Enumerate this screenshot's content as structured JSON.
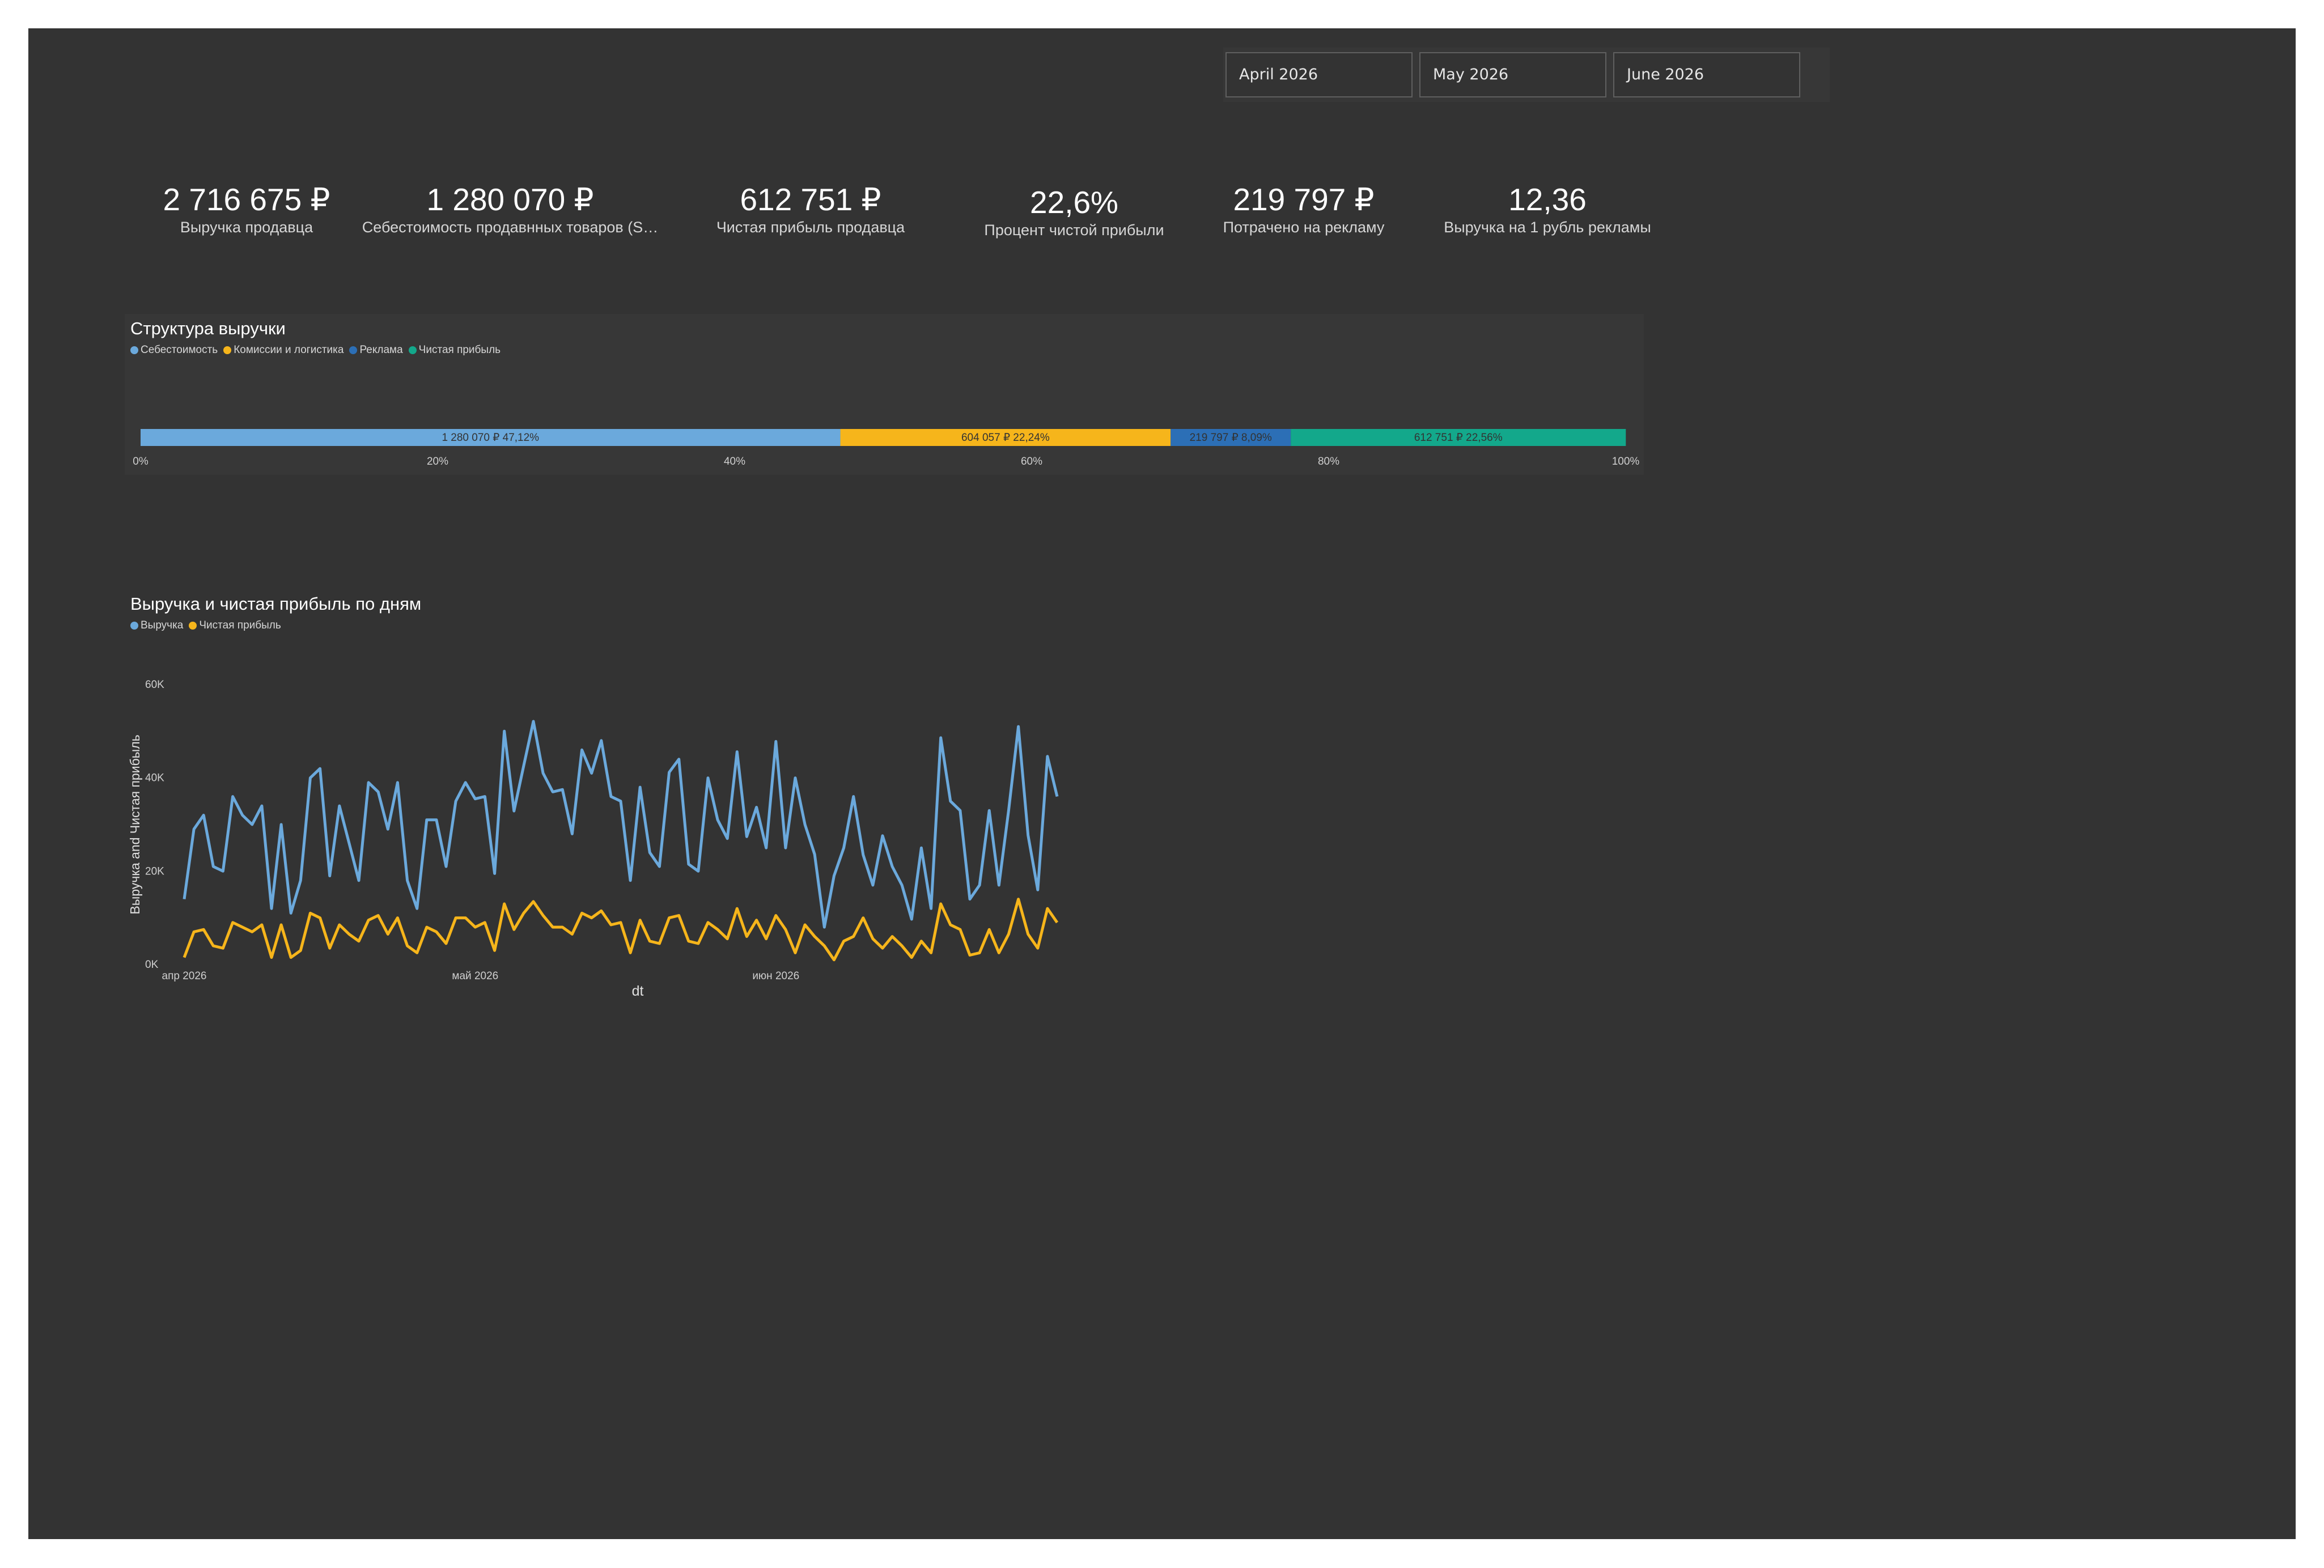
{
  "slicers": [
    {
      "label": "April 2026"
    },
    {
      "label": "May 2026"
    },
    {
      "label": "June 2026"
    }
  ],
  "kpis": [
    {
      "value": "2 716 675 ₽",
      "label": "Выручка продавца"
    },
    {
      "value": "1 280 070 ₽",
      "label": "Себестоимость продавнных товаров (S…"
    },
    {
      "value": "612 751 ₽",
      "label": "Чистая прибыль продавца"
    },
    {
      "value": "22,6%",
      "label": "Процент чистой прибыли"
    },
    {
      "value": "219 797 ₽",
      "label": "Потрачено на рекламу"
    },
    {
      "value": "12,36",
      "label": "Выручка на 1 рубль рекламы"
    }
  ],
  "structure": {
    "title": "Структура выручки",
    "legend": [
      {
        "label": "Себестоимость",
        "color": "#6ba9dc"
      },
      {
        "label": "Комиссии и логистика",
        "color": "#f6b51b"
      },
      {
        "label": "Реклама",
        "color": "#2c6fb6"
      },
      {
        "label": "Чистая прибыль",
        "color": "#13a88b"
      }
    ]
  },
  "daily": {
    "title": "Выручка и чистая прибыль по дням",
    "legend": [
      {
        "label": "Выручка",
        "color": "#6ba9dc"
      },
      {
        "label": "Чистая прибыль",
        "color": "#f6b51b"
      }
    ]
  },
  "chart_data": [
    {
      "type": "bar",
      "subtype": "100% stacked horizontal",
      "title": "Структура выручки",
      "series": [
        {
          "name": "Себестоимость",
          "value": 1280070,
          "percent": 47.12,
          "label": "1 280 070 ₽ 47,12%",
          "color": "#6ba9dc"
        },
        {
          "name": "Комиссии и логистика",
          "value": 604057,
          "percent": 22.24,
          "label": "604 057 ₽ 22,24%",
          "color": "#f6b51b"
        },
        {
          "name": "Реклама",
          "value": 219797,
          "percent": 8.09,
          "label": "219 797 ₽ 8,09%",
          "color": "#2c6fb6"
        },
        {
          "name": "Чистая прибыль",
          "value": 612751,
          "percent": 22.56,
          "label": "612 751 ₽ 22,56%",
          "color": "#13a88b"
        }
      ],
      "xticks": [
        "0%",
        "20%",
        "40%",
        "60%",
        "80%",
        "100%"
      ],
      "xlim": [
        0,
        100
      ],
      "legend": "top-left"
    },
    {
      "type": "line",
      "title": "Выручка и чистая прибыль по дням",
      "xlabel": "dt",
      "ylabel": "Выручка and Чистая прибыль",
      "x": [
        "2026-04-01",
        "2026-04-02",
        "2026-04-03",
        "2026-04-04",
        "2026-04-05",
        "2026-04-06",
        "2026-04-07",
        "2026-04-08",
        "2026-04-09",
        "2026-04-10",
        "2026-04-11",
        "2026-04-12",
        "2026-04-13",
        "2026-04-14",
        "2026-04-15",
        "2026-04-16",
        "2026-04-17",
        "2026-04-18",
        "2026-04-19",
        "2026-04-20",
        "2026-04-21",
        "2026-04-22",
        "2026-04-23",
        "2026-04-24",
        "2026-04-25",
        "2026-04-26",
        "2026-04-27",
        "2026-04-28",
        "2026-04-29",
        "2026-04-30",
        "2026-05-01",
        "2026-05-02",
        "2026-05-03",
        "2026-05-04",
        "2026-05-05",
        "2026-05-06",
        "2026-05-07",
        "2026-05-08",
        "2026-05-09",
        "2026-05-10",
        "2026-05-11",
        "2026-05-12",
        "2026-05-13",
        "2026-05-14",
        "2026-05-15",
        "2026-05-16",
        "2026-05-17",
        "2026-05-18",
        "2026-05-19",
        "2026-05-20",
        "2026-05-21",
        "2026-05-22",
        "2026-05-23",
        "2026-05-24",
        "2026-05-25",
        "2026-05-26",
        "2026-05-27",
        "2026-05-28",
        "2026-05-29",
        "2026-05-30",
        "2026-05-31",
        "2026-06-01",
        "2026-06-02",
        "2026-06-03",
        "2026-06-04",
        "2026-06-05",
        "2026-06-06",
        "2026-06-07",
        "2026-06-08",
        "2026-06-09",
        "2026-06-10",
        "2026-06-11",
        "2026-06-12",
        "2026-06-13",
        "2026-06-14",
        "2026-06-15",
        "2026-06-16",
        "2026-06-17",
        "2026-06-18",
        "2026-06-19",
        "2026-06-20",
        "2026-06-21",
        "2026-06-22",
        "2026-06-23",
        "2026-06-24",
        "2026-06-25",
        "2026-06-26",
        "2026-06-27",
        "2026-06-28",
        "2026-06-29",
        "2026-06-30"
      ],
      "series": [
        {
          "name": "Выручка",
          "color": "#6ba9dc",
          "values": [
            14000,
            29000,
            32000,
            21000,
            20000,
            36000,
            32000,
            30000,
            34000,
            12000,
            30000,
            11000,
            18000,
            40000,
            42000,
            19000,
            34000,
            26000,
            18000,
            39000,
            37000,
            29000,
            39000,
            18000,
            12000,
            31000,
            31000,
            21000,
            35000,
            39000,
            35500,
            36000,
            19500,
            50000,
            32900,
            42600,
            52100,
            41000,
            37000,
            37500,
            28000,
            46000,
            41000,
            48000,
            36000,
            35000,
            18000,
            38000,
            24000,
            21000,
            41200,
            44000,
            21500,
            20000,
            40000,
            31000,
            27000,
            45600,
            27400,
            33700,
            25000,
            47800,
            25000,
            40000,
            30000,
            23600,
            8000,
            19000,
            25000,
            36000,
            23500,
            17000,
            27600,
            21000,
            17000,
            9700,
            25000,
            12000,
            48600,
            35000,
            33000,
            14000,
            17000,
            33000,
            17000,
            33000,
            51000,
            27700,
            16000,
            44600,
            36000,
            20000
          ],
          "_note": "values approximate"
        },
        {
          "name": "Чистая прибыль",
          "color": "#f6b51b",
          "values": [
            1500,
            7000,
            7500,
            4000,
            3500,
            9000,
            8000,
            7000,
            8500,
            1500,
            8500,
            1500,
            3000,
            11000,
            10000,
            3500,
            8500,
            6500,
            5000,
            9500,
            10500,
            6500,
            10000,
            4000,
            2500,
            8000,
            7000,
            4500,
            10000,
            10000,
            8000,
            9000,
            3000,
            13000,
            7500,
            11000,
            13500,
            10500,
            8000,
            8000,
            6500,
            11000,
            10000,
            11500,
            8500,
            9000,
            2500,
            9500,
            5000,
            4500,
            10000,
            10500,
            5000,
            4500,
            9000,
            7500,
            5500,
            12000,
            6000,
            9500,
            5500,
            10500,
            7500,
            2500,
            8500,
            6000,
            4000,
            1000,
            5000,
            6000,
            10000,
            5500,
            3500,
            6000,
            4000,
            1500,
            5000,
            2500,
            13000,
            8500,
            7500,
            2000,
            2500,
            7500,
            2500,
            6500,
            14000,
            6500,
            3500,
            12000,
            9000,
            3500
          ]
        }
      ],
      "yticks": [
        "0K",
        "20K",
        "40K",
        "60K"
      ],
      "ylim": [
        0,
        60000
      ],
      "xticks": [
        "апр 2026",
        "май 2026",
        "июн 2026"
      ],
      "legend": "top-left"
    }
  ]
}
